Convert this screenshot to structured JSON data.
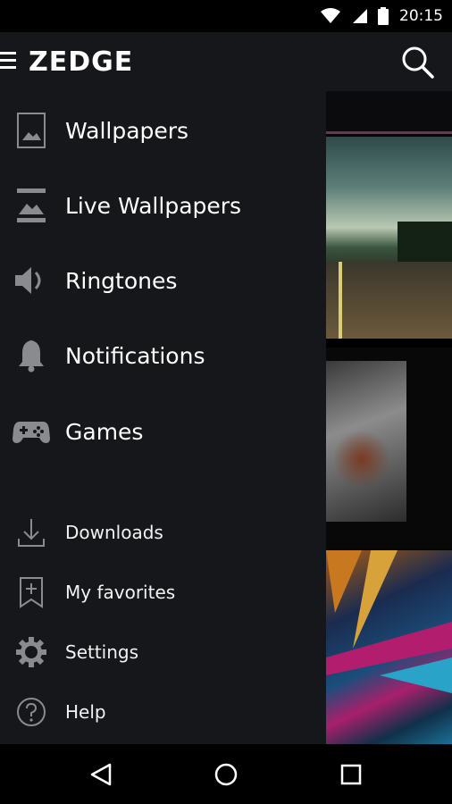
{
  "status_bar": {
    "time": "20:15",
    "icons": [
      "wifi-icon",
      "signal-icon",
      "battery-icon"
    ]
  },
  "app_bar": {
    "logo": "ZEDGE",
    "icons": [
      "menu-icon",
      "search-icon"
    ]
  },
  "drawer": {
    "primary_items": [
      {
        "label": "Wallpapers",
        "icon": "image-icon"
      },
      {
        "label": "Live Wallpapers",
        "icon": "live-wallpaper-icon"
      },
      {
        "label": "Ringtones",
        "icon": "speaker-icon"
      },
      {
        "label": "Notifications",
        "icon": "bell-icon"
      },
      {
        "label": "Games",
        "icon": "gamepad-icon"
      }
    ],
    "secondary_items": [
      {
        "label": "Downloads",
        "icon": "download-icon"
      },
      {
        "label": "My favorites",
        "icon": "bookmark-icon"
      },
      {
        "label": "Settings",
        "icon": "gear-icon"
      },
      {
        "label": "Help",
        "icon": "help-icon"
      }
    ]
  },
  "nav_bar": {
    "icons": [
      "back-icon",
      "home-icon",
      "recents-icon"
    ]
  },
  "colors": {
    "background": "#16171b",
    "accent_strip": "#5e3b53",
    "icon": "#8a8b8f"
  }
}
